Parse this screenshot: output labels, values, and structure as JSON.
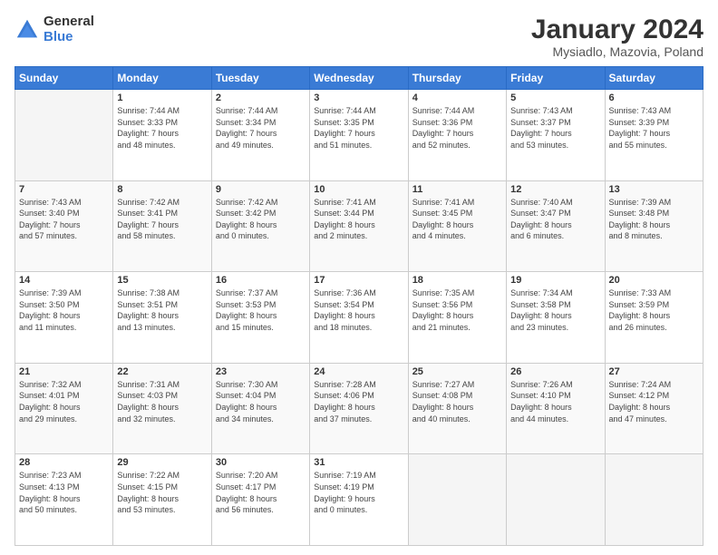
{
  "logo": {
    "general": "General",
    "blue": "Blue"
  },
  "title": "January 2024",
  "subtitle": "Mysiadlo, Mazovia, Poland",
  "weekdays": [
    "Sunday",
    "Monday",
    "Tuesday",
    "Wednesday",
    "Thursday",
    "Friday",
    "Saturday"
  ],
  "weeks": [
    [
      {
        "day": "",
        "info": ""
      },
      {
        "day": "1",
        "info": "Sunrise: 7:44 AM\nSunset: 3:33 PM\nDaylight: 7 hours\nand 48 minutes."
      },
      {
        "day": "2",
        "info": "Sunrise: 7:44 AM\nSunset: 3:34 PM\nDaylight: 7 hours\nand 49 minutes."
      },
      {
        "day": "3",
        "info": "Sunrise: 7:44 AM\nSunset: 3:35 PM\nDaylight: 7 hours\nand 51 minutes."
      },
      {
        "day": "4",
        "info": "Sunrise: 7:44 AM\nSunset: 3:36 PM\nDaylight: 7 hours\nand 52 minutes."
      },
      {
        "day": "5",
        "info": "Sunrise: 7:43 AM\nSunset: 3:37 PM\nDaylight: 7 hours\nand 53 minutes."
      },
      {
        "day": "6",
        "info": "Sunrise: 7:43 AM\nSunset: 3:39 PM\nDaylight: 7 hours\nand 55 minutes."
      }
    ],
    [
      {
        "day": "7",
        "info": "Sunrise: 7:43 AM\nSunset: 3:40 PM\nDaylight: 7 hours\nand 57 minutes."
      },
      {
        "day": "8",
        "info": "Sunrise: 7:42 AM\nSunset: 3:41 PM\nDaylight: 7 hours\nand 58 minutes."
      },
      {
        "day": "9",
        "info": "Sunrise: 7:42 AM\nSunset: 3:42 PM\nDaylight: 8 hours\nand 0 minutes."
      },
      {
        "day": "10",
        "info": "Sunrise: 7:41 AM\nSunset: 3:44 PM\nDaylight: 8 hours\nand 2 minutes."
      },
      {
        "day": "11",
        "info": "Sunrise: 7:41 AM\nSunset: 3:45 PM\nDaylight: 8 hours\nand 4 minutes."
      },
      {
        "day": "12",
        "info": "Sunrise: 7:40 AM\nSunset: 3:47 PM\nDaylight: 8 hours\nand 6 minutes."
      },
      {
        "day": "13",
        "info": "Sunrise: 7:39 AM\nSunset: 3:48 PM\nDaylight: 8 hours\nand 8 minutes."
      }
    ],
    [
      {
        "day": "14",
        "info": "Sunrise: 7:39 AM\nSunset: 3:50 PM\nDaylight: 8 hours\nand 11 minutes."
      },
      {
        "day": "15",
        "info": "Sunrise: 7:38 AM\nSunset: 3:51 PM\nDaylight: 8 hours\nand 13 minutes."
      },
      {
        "day": "16",
        "info": "Sunrise: 7:37 AM\nSunset: 3:53 PM\nDaylight: 8 hours\nand 15 minutes."
      },
      {
        "day": "17",
        "info": "Sunrise: 7:36 AM\nSunset: 3:54 PM\nDaylight: 8 hours\nand 18 minutes."
      },
      {
        "day": "18",
        "info": "Sunrise: 7:35 AM\nSunset: 3:56 PM\nDaylight: 8 hours\nand 21 minutes."
      },
      {
        "day": "19",
        "info": "Sunrise: 7:34 AM\nSunset: 3:58 PM\nDaylight: 8 hours\nand 23 minutes."
      },
      {
        "day": "20",
        "info": "Sunrise: 7:33 AM\nSunset: 3:59 PM\nDaylight: 8 hours\nand 26 minutes."
      }
    ],
    [
      {
        "day": "21",
        "info": "Sunrise: 7:32 AM\nSunset: 4:01 PM\nDaylight: 8 hours\nand 29 minutes."
      },
      {
        "day": "22",
        "info": "Sunrise: 7:31 AM\nSunset: 4:03 PM\nDaylight: 8 hours\nand 32 minutes."
      },
      {
        "day": "23",
        "info": "Sunrise: 7:30 AM\nSunset: 4:04 PM\nDaylight: 8 hours\nand 34 minutes."
      },
      {
        "day": "24",
        "info": "Sunrise: 7:28 AM\nSunset: 4:06 PM\nDaylight: 8 hours\nand 37 minutes."
      },
      {
        "day": "25",
        "info": "Sunrise: 7:27 AM\nSunset: 4:08 PM\nDaylight: 8 hours\nand 40 minutes."
      },
      {
        "day": "26",
        "info": "Sunrise: 7:26 AM\nSunset: 4:10 PM\nDaylight: 8 hours\nand 44 minutes."
      },
      {
        "day": "27",
        "info": "Sunrise: 7:24 AM\nSunset: 4:12 PM\nDaylight: 8 hours\nand 47 minutes."
      }
    ],
    [
      {
        "day": "28",
        "info": "Sunrise: 7:23 AM\nSunset: 4:13 PM\nDaylight: 8 hours\nand 50 minutes."
      },
      {
        "day": "29",
        "info": "Sunrise: 7:22 AM\nSunset: 4:15 PM\nDaylight: 8 hours\nand 53 minutes."
      },
      {
        "day": "30",
        "info": "Sunrise: 7:20 AM\nSunset: 4:17 PM\nDaylight: 8 hours\nand 56 minutes."
      },
      {
        "day": "31",
        "info": "Sunrise: 7:19 AM\nSunset: 4:19 PM\nDaylight: 9 hours\nand 0 minutes."
      },
      {
        "day": "",
        "info": ""
      },
      {
        "day": "",
        "info": ""
      },
      {
        "day": "",
        "info": ""
      }
    ]
  ]
}
